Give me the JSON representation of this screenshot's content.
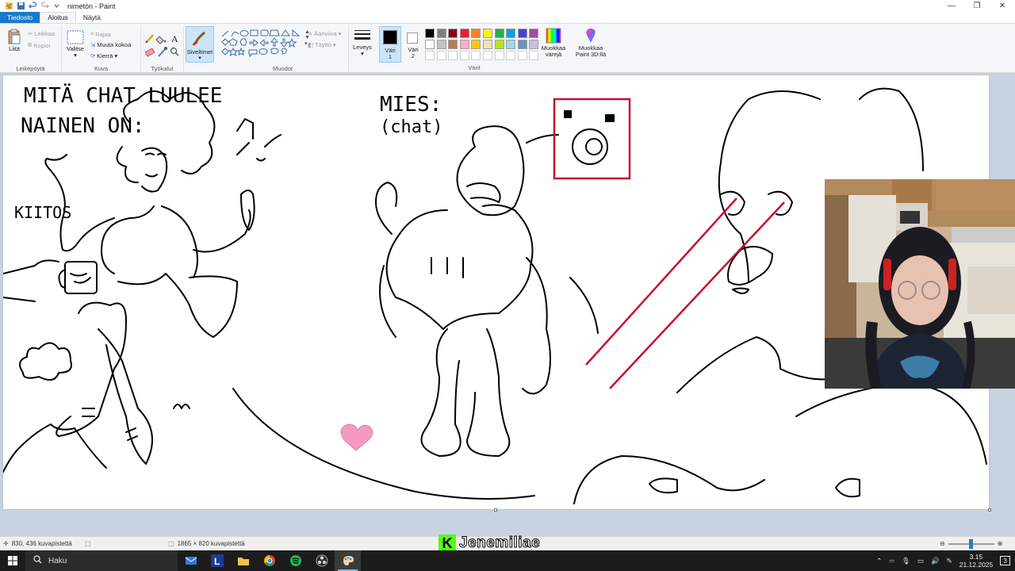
{
  "window": {
    "title": "nimetön - Paint",
    "controls": [
      "minimize",
      "maximize",
      "close"
    ]
  },
  "tabs": [
    {
      "label": "Tiedosto",
      "kind": "file"
    },
    {
      "label": "Aloitus",
      "kind": "active"
    },
    {
      "label": "Näytä",
      "kind": "normal"
    }
  ],
  "ribbon": {
    "clipboard": {
      "paste": "Liitä",
      "cut": "Leikkaa",
      "copy": "Kopioi",
      "group": "Leikepöytä"
    },
    "image": {
      "select": "Valitse",
      "crop": "Rajaa",
      "resize": "Muuta kokoa",
      "rotate": "Kierrä",
      "group": "Kuva"
    },
    "tools": {
      "group": "Työkalut"
    },
    "brushes": {
      "label": "Siveltimet"
    },
    "shapes": {
      "outline": "Ääriviiva",
      "fill": "Täyttö",
      "group": "Muodot"
    },
    "size": {
      "label": "Leveys"
    },
    "color1": {
      "label_line1": "Väri",
      "label_line2": "1",
      "color": "#000000"
    },
    "color2": {
      "label_line1": "Väri",
      "label_line2": "2",
      "color": "#ffffff"
    },
    "colors_group": "Värit",
    "edit_colors": {
      "line1": "Muokkaa",
      "line2": "värejä"
    },
    "paint3d": {
      "line1": "Muokkaa",
      "line2": "Paint 3D:llä"
    },
    "palette_row1": [
      "#000000",
      "#7f7f7f",
      "#880015",
      "#ed1c24",
      "#ff7f27",
      "#fff200",
      "#22b14c",
      "#00a2e8",
      "#3f48cc",
      "#a349a4"
    ],
    "palette_row2": [
      "#ffffff",
      "#c3c3c3",
      "#b97a57",
      "#ffaec9",
      "#ffc90e",
      "#efe4b0",
      "#b5e61d",
      "#99d9ea",
      "#7092be",
      "#c8bfe7"
    ]
  },
  "drawing": {
    "text_top_left_1": "MITÄ CHAT LUULEE",
    "text_top_left_2": "NAINEN ON:",
    "text_kiitos": "KIITOS",
    "text_mies": "MIES:",
    "text_chat": "(chat)"
  },
  "status": {
    "cursor_pos": "830, 436 kuvapistettä",
    "canvas_size": "1865 × 820 kuvapistettä"
  },
  "watermark": {
    "letter": "K",
    "name": "Jenemiliae"
  },
  "taskbar": {
    "search_placeholder": "Haku",
    "time": "3.15",
    "date": "21.12.2025",
    "notifications": "3"
  }
}
